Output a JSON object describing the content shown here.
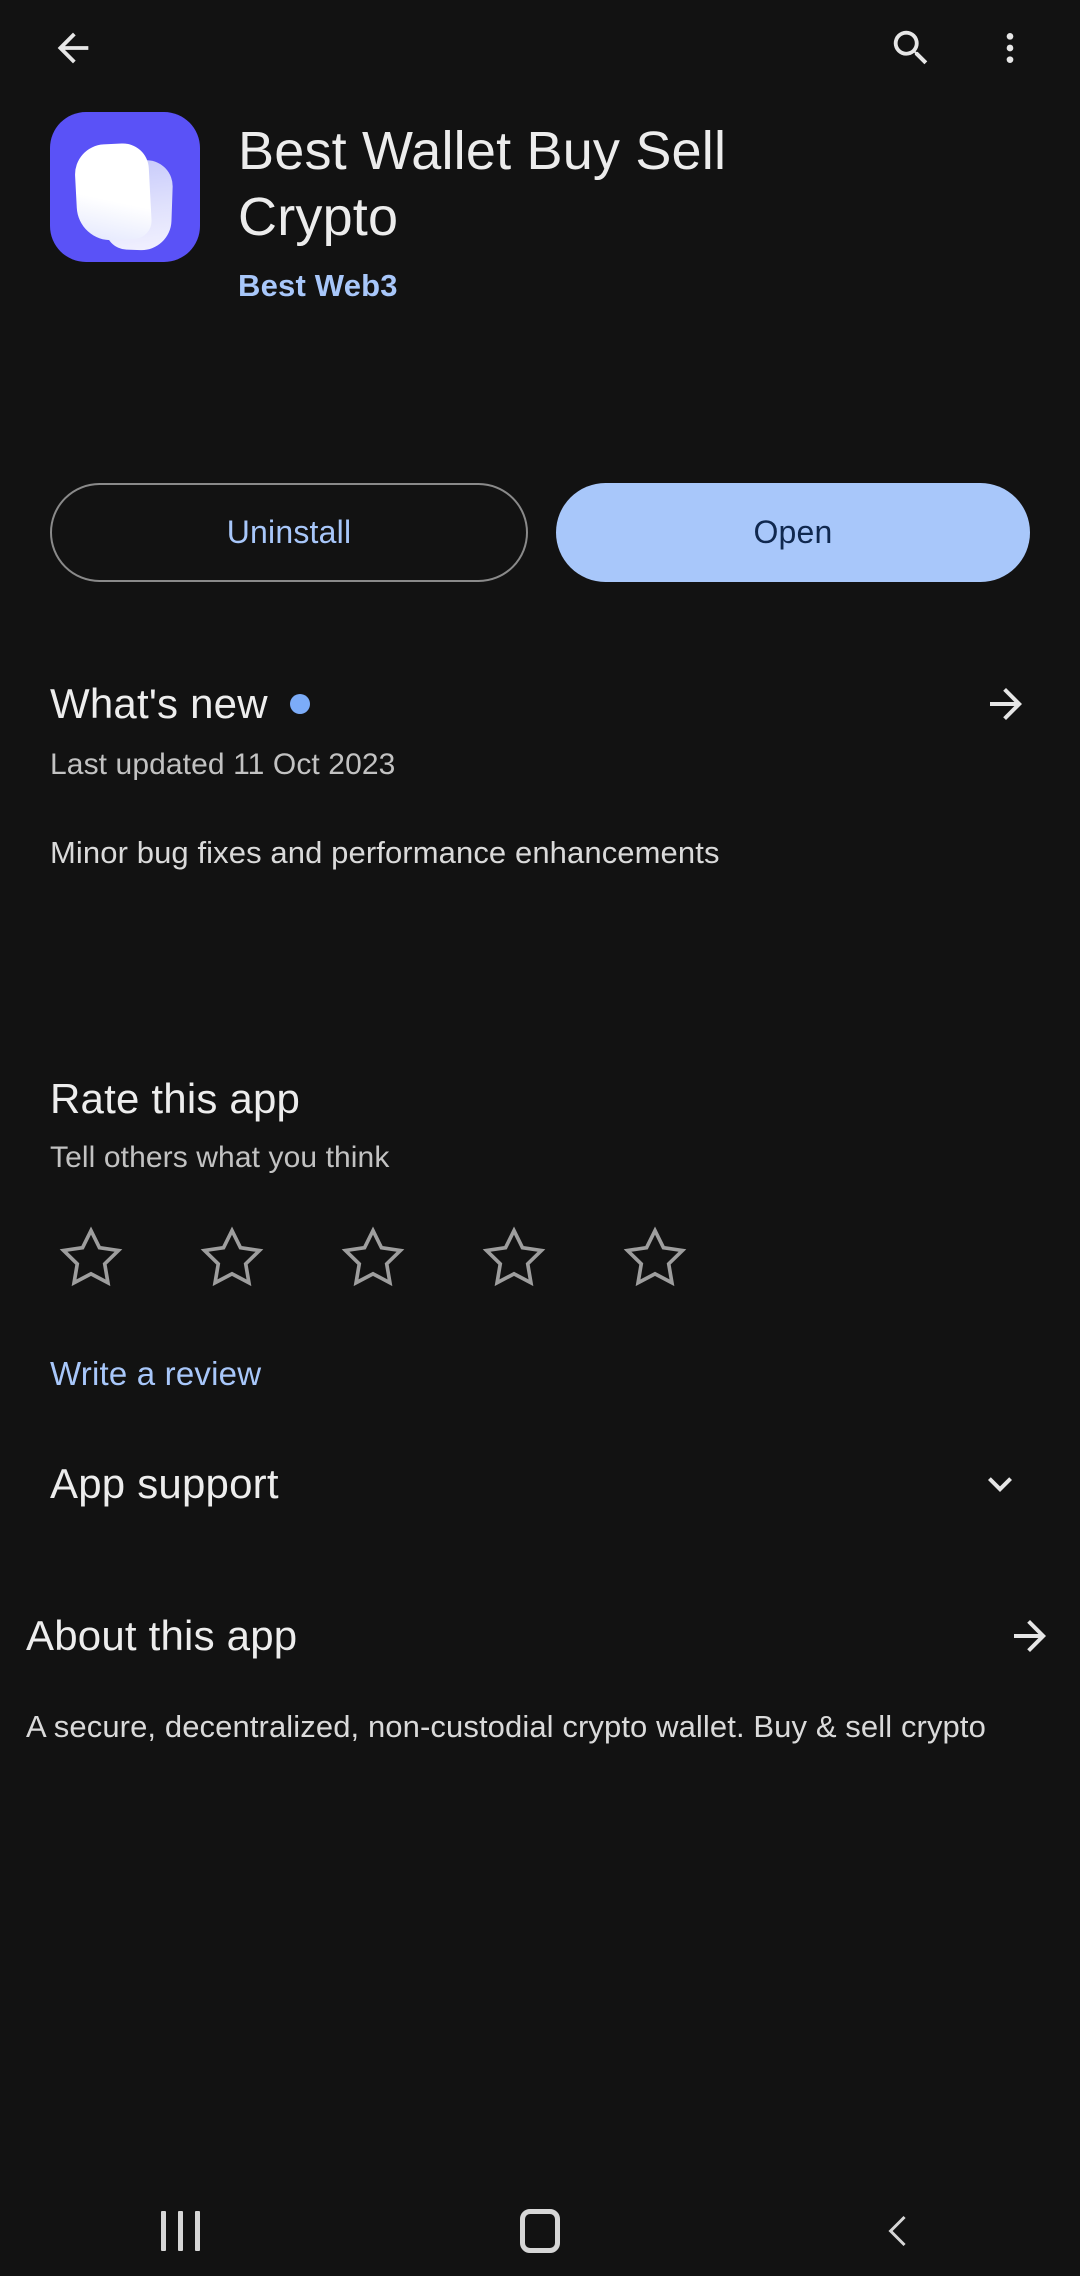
{
  "appbar": {
    "back_icon": "arrow-left-icon",
    "search_icon": "search-icon",
    "overflow_icon": "more-vert-icon"
  },
  "app": {
    "icon_name": "best-wallet-app-icon",
    "icon_bg_color": "#5A52F7",
    "title": "Best Wallet Buy Sell Crypto",
    "developer": "Best Web3",
    "developer_color": "#A8C7FA"
  },
  "actions": {
    "uninstall_label": "Uninstall",
    "open_label": "Open",
    "open_bg_color": "#A8C7FA"
  },
  "whats_new": {
    "title": "What's new",
    "badge_dot_color": "#7CACF8",
    "last_updated": "Last updated 11 Oct 2023",
    "body": "Minor bug fixes and performance enhancements",
    "arrow_icon": "arrow-right-icon"
  },
  "rate_app": {
    "title": "Rate this app",
    "subtitle": "Tell others what you think",
    "stars_total": 5,
    "stars_selected": 0,
    "star_icon": "star-outline-icon",
    "write_review_label": "Write a review"
  },
  "app_support": {
    "title": "App support",
    "chevron_icon": "chevron-down-icon"
  },
  "about_app": {
    "title": "About this app",
    "arrow_icon": "arrow-right-icon",
    "body": "A secure, decentralized, non-custodial crypto wallet. Buy & sell crypto"
  },
  "navbar": {
    "recents_icon": "recents-icon",
    "home_icon": "home-icon",
    "back_icon": "nav-back-icon"
  }
}
